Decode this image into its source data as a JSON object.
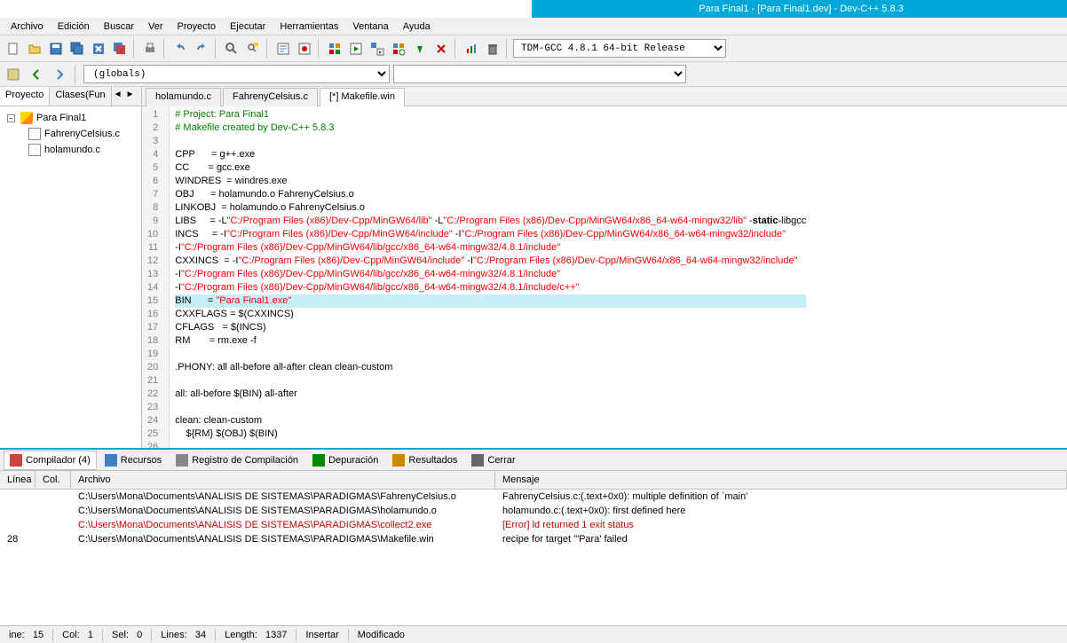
{
  "title": "Para Final1 - [Para Final1.dev] - Dev-C++ 5.8.3",
  "menu": [
    "Archivo",
    "Edición",
    "Buscar",
    "Ver",
    "Proyecto",
    "Ejecutar",
    "Herramientas",
    "Ventana",
    "Ayuda"
  ],
  "compiler_select": "TDM-GCC 4.8.1 64-bit Release",
  "globals": "(globals)",
  "side_tabs": {
    "proyecto": "Proyecto",
    "clases": "Clases(Fun"
  },
  "project_name": "Para Final1",
  "project_files": [
    "FahrenyCelsius.c",
    "holamundo.c"
  ],
  "editor_tabs": [
    "holamundo.c",
    "FahrenyCelsius.c",
    "[*] Makefile.win"
  ],
  "code_lines": [
    {
      "n": 1,
      "html": "<span class='c-comment'># Project: Para Final1</span>"
    },
    {
      "n": 2,
      "html": "<span class='c-comment'># Makefile created by Dev-C++ 5.8.3</span>"
    },
    {
      "n": 3,
      "html": ""
    },
    {
      "n": 4,
      "html": "CPP      = g++.exe"
    },
    {
      "n": 5,
      "html": "CC       = gcc.exe"
    },
    {
      "n": 6,
      "html": "WINDRES  = windres.exe"
    },
    {
      "n": 7,
      "html": "OBJ      = holamundo.o FahrenyCelsius.o"
    },
    {
      "n": 8,
      "html": "LINKOBJ  = holamundo.o FahrenyCelsius.o"
    },
    {
      "n": 9,
      "html": "LIBS     = -L<span class='c-str'>\"C:/Program Files (x86)/Dev-Cpp/MinGW64/lib\"</span> -L<span class='c-str'>\"C:/Program Files (x86)/Dev-Cpp/MinGW64/x86_64-w64-mingw32/lib\"</span> -<span class='c-kw'>static</span>-libgcc"
    },
    {
      "n": 10,
      "html": "INCS     = -I<span class='c-str'>\"C:/Program Files (x86)/Dev-Cpp/MinGW64/include\"</span> -I<span class='c-str'>\"C:/Program Files (x86)/Dev-Cpp/MinGW64/x86_64-w64-mingw32/include\"</span>"
    },
    {
      "n": 11,
      "html": "-I<span class='c-str'>\"C:/Program Files (x86)/Dev-Cpp/MinGW64/lib/gcc/x86_64-w64-mingw32/4.8.1/include\"</span>"
    },
    {
      "n": 12,
      "html": "CXXINCS  = -I<span class='c-str'>\"C:/Program Files (x86)/Dev-Cpp/MinGW64/include\"</span> -I<span class='c-str'>\"C:/Program Files (x86)/Dev-Cpp/MinGW64/x86_64-w64-mingw32/include\"</span>"
    },
    {
      "n": 13,
      "html": "-I<span class='c-str'>\"C:/Program Files (x86)/Dev-Cpp/MinGW64/lib/gcc/x86_64-w64-mingw32/4.8.1/include\"</span>"
    },
    {
      "n": 14,
      "html": "-I<span class='c-str'>\"C:/Program Files (x86)/Dev-Cpp/MinGW64/lib/gcc/x86_64-w64-mingw32/4.8.1/include/c++\"</span>"
    },
    {
      "n": 15,
      "html": "BIN      = <span class='c-str'>\"Para Final1.exe\"</span>",
      "hl": true
    },
    {
      "n": 16,
      "html": "CXXFLAGS = $(CXXINCS)"
    },
    {
      "n": 17,
      "html": "CFLAGS   = $(INCS)"
    },
    {
      "n": 18,
      "html": "RM       = rm.exe -f"
    },
    {
      "n": 19,
      "html": ""
    },
    {
      "n": 20,
      "html": ".PHONY: all all-before all-after clean clean-custom"
    },
    {
      "n": 21,
      "html": ""
    },
    {
      "n": 22,
      "html": "all: all-before $(BIN) all-after"
    },
    {
      "n": 23,
      "html": ""
    },
    {
      "n": 24,
      "html": "clean: clean-custom"
    },
    {
      "n": 25,
      "html": "    ${RM} $(OBJ) $(BIN)"
    },
    {
      "n": 26,
      "html": ""
    }
  ],
  "bottom_tabs": [
    {
      "label": "Compilador (4)",
      "active": true
    },
    {
      "label": "Recursos"
    },
    {
      "label": "Registro de Compilación"
    },
    {
      "label": "Depuración"
    },
    {
      "label": "Resultados"
    },
    {
      "label": "Cerrar"
    }
  ],
  "output_headers": {
    "line": "Línea",
    "col": "Col.",
    "file": "Archivo",
    "msg": "Mensaje"
  },
  "output_rows": [
    {
      "line": "",
      "col": "",
      "file": "C:\\Users\\Mona\\Documents\\ANALISIS DE SISTEMAS\\PARADIGMAS\\FahrenyCelsius.o",
      "msg": "FahrenyCelsius.c:(.text+0x0): multiple definition of `main'"
    },
    {
      "line": "",
      "col": "",
      "file": "C:\\Users\\Mona\\Documents\\ANALISIS DE SISTEMAS\\PARADIGMAS\\holamundo.o",
      "msg": "holamundo.c:(.text+0x0): first defined here"
    },
    {
      "line": "",
      "col": "",
      "file": "C:\\Users\\Mona\\Documents\\ANALISIS DE SISTEMAS\\PARADIGMAS\\collect2.exe",
      "msg": "[Error] ld returned 1 exit status",
      "error": true
    },
    {
      "line": "28",
      "col": "",
      "file": "C:\\Users\\Mona\\Documents\\ANALISIS DE SISTEMAS\\PARADIGMAS\\Makefile.win",
      "msg": "recipe for target '\"Para' failed"
    }
  ],
  "status": {
    "line_lbl": "ine:",
    "line": "15",
    "col_lbl": "Col:",
    "col": "1",
    "sel_lbl": "Sel:",
    "sel": "0",
    "lines_lbl": "Lines:",
    "lines": "34",
    "length_lbl": "Length:",
    "length": "1337",
    "insert": "Insertar",
    "modified": "Modificado"
  }
}
